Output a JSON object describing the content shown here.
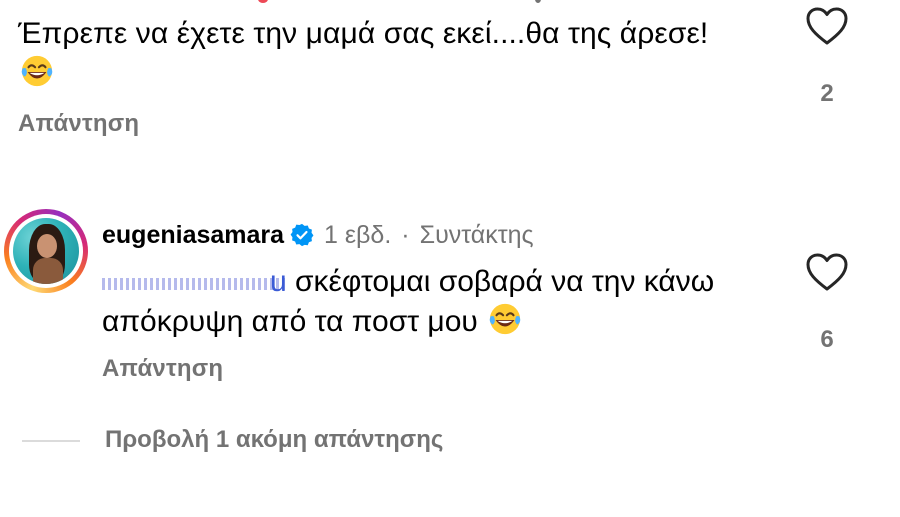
{
  "comment1": {
    "text": "Έπρεπε να έχετε την μαμά σας εκεί....θα της άρεσε!",
    "emoji": "face-with-tears-of-joy-emoji",
    "reply_label": "Απάντηση",
    "like_count": "2"
  },
  "comment2": {
    "username": "eugeniasamara",
    "verified": true,
    "time": "1 εβδ.",
    "separator": "·",
    "role": "Συντάκτης",
    "mention_tail": "u",
    "text": "σκέφτομαι σοβαρά να την κάνω απόκρυψη από τα ποστ μου",
    "emoji": "face-with-tears-of-joy-emoji",
    "reply_label": "Απάντηση",
    "like_count": "6"
  },
  "view_more_replies": "Προβολή 1 ακόμη απάντησης",
  "colors": {
    "secondary_text": "#737373",
    "verified_blue": "#0095f6",
    "link_blue": "#00376b"
  }
}
